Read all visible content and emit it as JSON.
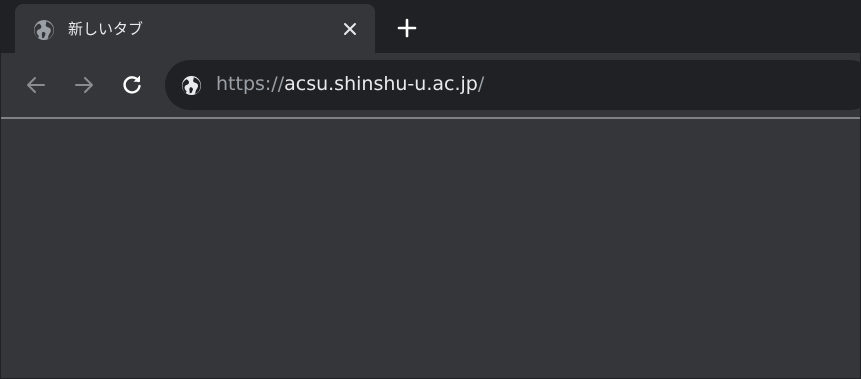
{
  "tab": {
    "title": "新しいタブ",
    "favicon": "globe-icon"
  },
  "toolbar": {
    "back_icon": "arrow-left-icon",
    "forward_icon": "arrow-right-icon",
    "reload_icon": "reload-icon"
  },
  "omnibox": {
    "site_icon": "globe-icon",
    "url_scheme": "https://",
    "url_host": "acsu.shinshu-u.ac.jp",
    "url_path": "/"
  },
  "colors": {
    "tabstrip_bg": "#202124",
    "toolbar_bg": "#35363a",
    "omnibox_bg": "#202124",
    "text_primary": "#e8eaed",
    "text_secondary": "#9aa0a6",
    "icon_disabled": "#8a8c8f"
  }
}
